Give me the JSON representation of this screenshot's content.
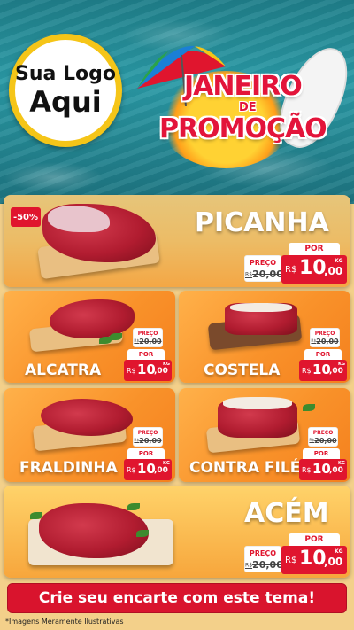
{
  "logo": {
    "line1": "Sua Logo",
    "line2": "Aqui"
  },
  "promo": {
    "line1": "JANEIRO",
    "line2": "DE",
    "line3": "PROMOÇÃO"
  },
  "products": {
    "picanha": {
      "name": "PICANHA",
      "discount": "-50%",
      "old_label": "PREÇO",
      "old_currency": "R$",
      "old_price": "20,00",
      "por_label": "POR",
      "currency": "R$",
      "price_int": "10",
      "price_dec": ",00",
      "unit": "KG"
    },
    "alcatra": {
      "name": "ALCATRA",
      "old_label": "PREÇO",
      "old_currency": "R$",
      "old_price": "20,00",
      "por_label": "POR",
      "currency": "R$",
      "price_int": "10",
      "price_dec": ",00",
      "unit": "KG"
    },
    "costela": {
      "name": "COSTELA",
      "old_label": "PREÇO",
      "old_currency": "R$",
      "old_price": "20,00",
      "por_label": "POR",
      "currency": "R$",
      "price_int": "10",
      "price_dec": ",00",
      "unit": "KG"
    },
    "fraldinha": {
      "name": "FRALDINHA",
      "old_label": "PREÇO",
      "old_currency": "R$",
      "old_price": "20,00",
      "por_label": "POR",
      "currency": "R$",
      "price_int": "10",
      "price_dec": ",00",
      "unit": "KG"
    },
    "contrafile": {
      "name": "CONTRA FILÉ",
      "old_label": "PREÇO",
      "old_currency": "R$",
      "old_price": "20,00",
      "por_label": "POR",
      "currency": "R$",
      "price_int": "10",
      "price_dec": ",00",
      "unit": "KG"
    },
    "acem": {
      "name": "ACÉM",
      "old_label": "PREÇO",
      "old_currency": "R$",
      "old_price": "20,00",
      "por_label": "POR",
      "currency": "R$",
      "price_int": "10",
      "price_dec": ",00",
      "unit": "KG"
    }
  },
  "cta": {
    "label": "Crie seu encarte com este tema!"
  },
  "footnote": "*Imagens Meramente Ilustrativas",
  "colors": {
    "accent_red": "#e0152e",
    "brand_yellow": "#f5c518",
    "card_orange": "#f9922a",
    "pool_teal": "#2a9aa6"
  },
  "icons": [
    "umbrella-icon",
    "sun-icon",
    "surfboard-icon"
  ]
}
